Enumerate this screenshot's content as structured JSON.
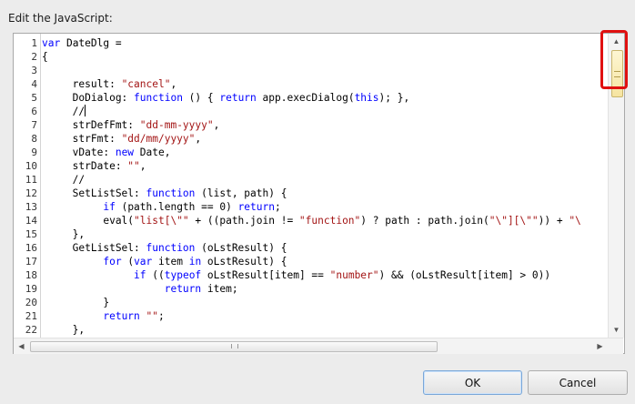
{
  "dialog": {
    "label": "Edit the JavaScript:"
  },
  "editor": {
    "line_numbers": [
      "1",
      "2",
      "3",
      "4",
      "5",
      "6",
      "7",
      "8",
      "9",
      "10",
      "11",
      "12",
      "13",
      "14",
      "15",
      "16",
      "17",
      "18",
      "19",
      "20",
      "21",
      "22"
    ],
    "lines": [
      [
        {
          "t": "var",
          "c": "kw"
        },
        {
          "t": " DateDlg ="
        }
      ],
      [
        {
          "t": "{"
        }
      ],
      [
        {
          "t": ""
        }
      ],
      [
        {
          "t": "     result: "
        },
        {
          "t": "\"cancel\"",
          "c": "str"
        },
        {
          "t": ","
        }
      ],
      [
        {
          "t": "     DoDialog: "
        },
        {
          "t": "function",
          "c": "kw"
        },
        {
          "t": " () { "
        },
        {
          "t": "return",
          "c": "kw"
        },
        {
          "t": " app.execDialog("
        },
        {
          "t": "this",
          "c": "kw"
        },
        {
          "t": "); },"
        }
      ],
      [
        {
          "t": "     //",
          "c": "cm"
        }
      ],
      [
        {
          "t": "     strDefFmt: "
        },
        {
          "t": "\"dd-mm-yyyy\"",
          "c": "str"
        },
        {
          "t": ","
        }
      ],
      [
        {
          "t": "     strFmt: "
        },
        {
          "t": "\"dd/mm/yyyy\"",
          "c": "str"
        },
        {
          "t": ","
        }
      ],
      [
        {
          "t": "     vDate: "
        },
        {
          "t": "new",
          "c": "kw"
        },
        {
          "t": " Date,"
        }
      ],
      [
        {
          "t": "     strDate: "
        },
        {
          "t": "\"\"",
          "c": "str"
        },
        {
          "t": ","
        }
      ],
      [
        {
          "t": "     //"
        }
      ],
      [
        {
          "t": "     SetListSel: "
        },
        {
          "t": "function",
          "c": "kw"
        },
        {
          "t": " (list, path) {"
        }
      ],
      [
        {
          "t": "          "
        },
        {
          "t": "if",
          "c": "kw"
        },
        {
          "t": " (path.length == 0) "
        },
        {
          "t": "return",
          "c": "kw"
        },
        {
          "t": ";"
        }
      ],
      [
        {
          "t": "          eval("
        },
        {
          "t": "\"list[\\\"\"",
          "c": "str"
        },
        {
          "t": " + ((path.join != "
        },
        {
          "t": "\"function\"",
          "c": "str"
        },
        {
          "t": ") ? path : path.join("
        },
        {
          "t": "\"\\\"][\\\"\"",
          "c": "str"
        },
        {
          "t": ")) + "
        },
        {
          "t": "\"\\",
          "c": "str"
        }
      ],
      [
        {
          "t": "     },"
        }
      ],
      [
        {
          "t": "     GetListSel: "
        },
        {
          "t": "function",
          "c": "kw"
        },
        {
          "t": " (oLstResult) {"
        }
      ],
      [
        {
          "t": "          "
        },
        {
          "t": "for",
          "c": "kw"
        },
        {
          "t": " ("
        },
        {
          "t": "var",
          "c": "kw"
        },
        {
          "t": " item "
        },
        {
          "t": "in",
          "c": "kw"
        },
        {
          "t": " oLstResult) {"
        }
      ],
      [
        {
          "t": "               "
        },
        {
          "t": "if",
          "c": "kw"
        },
        {
          "t": " (("
        },
        {
          "t": "typeof",
          "c": "kw"
        },
        {
          "t": " oLstResult[item] == "
        },
        {
          "t": "\"number\"",
          "c": "str"
        },
        {
          "t": ") && (oLstResult[item] > 0))"
        }
      ],
      [
        {
          "t": "                    "
        },
        {
          "t": "return",
          "c": "kw"
        },
        {
          "t": " item;"
        }
      ],
      [
        {
          "t": "          }"
        }
      ],
      [
        {
          "t": "          "
        },
        {
          "t": "return",
          "c": "kw"
        },
        {
          "t": " "
        },
        {
          "t": "\"\"",
          "c": "str"
        },
        {
          "t": ";"
        }
      ],
      [
        {
          "t": "     },"
        }
      ]
    ],
    "caret_line": 6
  },
  "buttons": {
    "ok": "OK",
    "cancel": "Cancel"
  },
  "colors": {
    "keyword": "#0000ff",
    "string": "#a31515",
    "highlight": "#e01010"
  },
  "icons": {
    "up": "scroll-up-arrow-icon",
    "down": "scroll-down-arrow-icon",
    "left": "scroll-left-arrow-icon",
    "right": "scroll-right-arrow-icon"
  }
}
